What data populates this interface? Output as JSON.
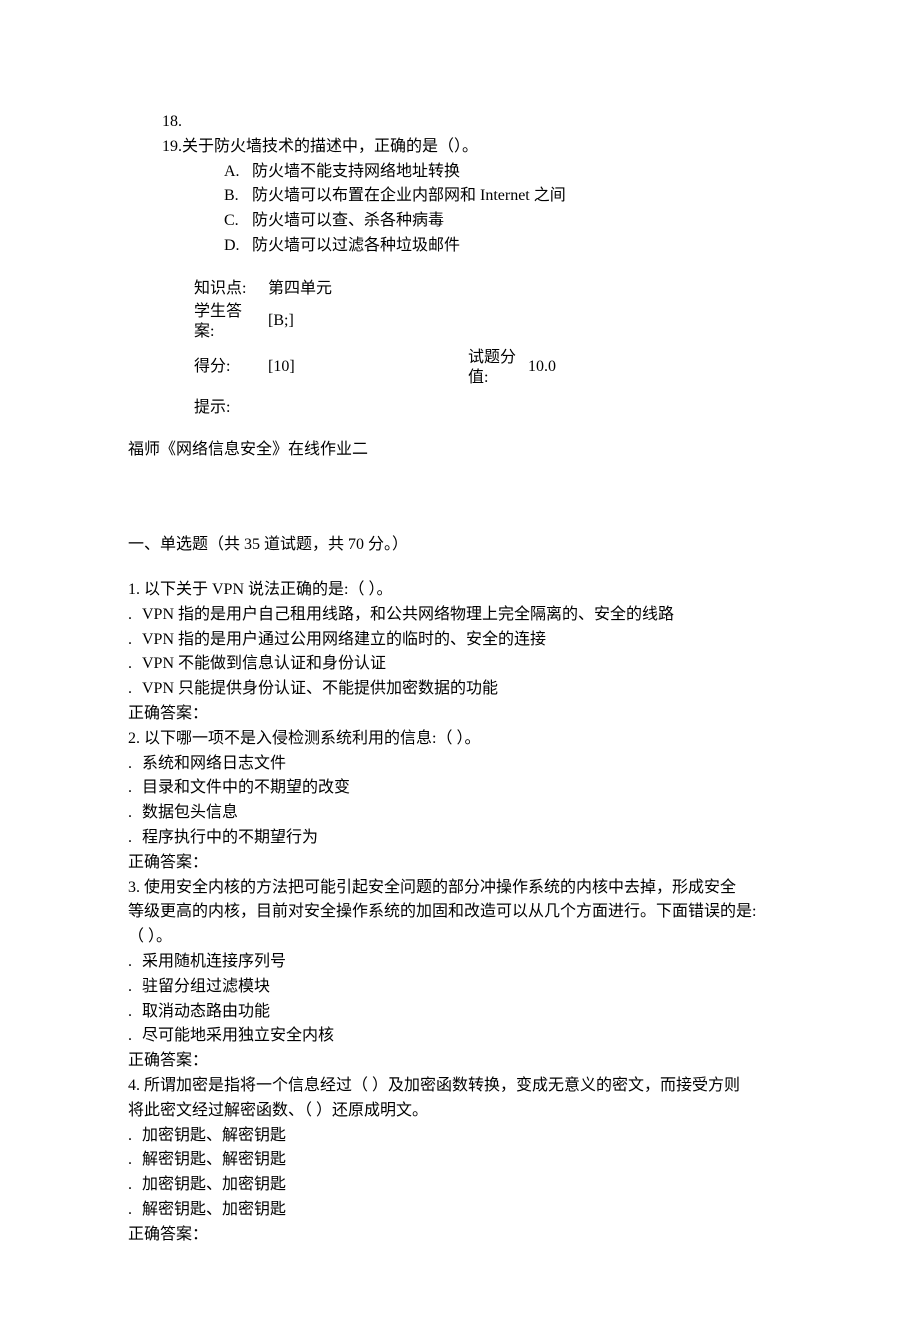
{
  "q18": {
    "num": "18."
  },
  "q19": {
    "num": "19.",
    "stem": "关于防火墙技术的描述中，正确的是（）。",
    "options": {
      "A": {
        "label": "A.",
        "text": "防火墙不能支持网络地址转换"
      },
      "B": {
        "label": "B.",
        "text": "防火墙可以布置在企业内部网和 Internet 之间"
      },
      "C": {
        "label": "C.",
        "text": "防火墙可以查、杀各种病毒"
      },
      "D": {
        "label": "D.",
        "text": "防火墙可以过滤各种垃圾邮件"
      }
    },
    "meta": {
      "knowledge_label": "知识点:",
      "knowledge_value": "第四单元",
      "student_answer_label_l1": "学生答",
      "student_answer_label_l2": "案:",
      "student_answer_value": "[B;]",
      "score_label": "得分:",
      "score_value": "[10]",
      "item_score_label_l1": "试题分",
      "item_score_label_l2": "值:",
      "item_score_value": "10.0",
      "hint_label": "提示:"
    }
  },
  "hw2": {
    "title": "福师《网络信息安全》在线作业二",
    "section_title": "一、单选题（共 35 道试题，共 70 分。）",
    "q1": {
      "stem": "1.  以下关于 VPN 说法正确的是:（ ）。",
      "opts": [
        "VPN 指的是用户自己租用线路，和公共网络物理上完全隔离的、安全的线路",
        "VPN 指的是用户通过公用网络建立的临时的、安全的连接",
        "VPN 不能做到信息认证和身份认证",
        "VPN 只能提供身份认证、不能提供加密数据的功能"
      ],
      "answer_label": "正确答案："
    },
    "q2": {
      "stem": "2.  以下哪一项不是入侵检测系统利用的信息:（ ）。",
      "opts": [
        "系统和网络日志文件",
        "目录和文件中的不期望的改变",
        "数据包头信息",
        "程序执行中的不期望行为"
      ],
      "answer_label": "正确答案："
    },
    "q3": {
      "stem_l1": "3.  使用安全内核的方法把可能引起安全问题的部分冲操作系统的内核中去掉，形成安全",
      "stem_l2": "等级更高的内核，目前对安全操作系统的加固和改造可以从几个方面进行。下面错误的是:",
      "stem_l3": "（ ）。",
      "opts": [
        "采用随机连接序列号",
        "驻留分组过滤模块",
        "取消动态路由功能",
        "尽可能地采用独立安全内核"
      ],
      "answer_label": "正确答案："
    },
    "q4": {
      "stem_l1": "4.  所谓加密是指将一个信息经过（ ）及加密函数转换，变成无意义的密文，而接受方则",
      "stem_l2": "将此密文经过解密函数、（ ）还原成明文。",
      "opts": [
        "加密钥匙、解密钥匙",
        "解密钥匙、解密钥匙",
        "加密钥匙、加密钥匙",
        "解密钥匙、加密钥匙"
      ],
      "answer_label": "正确答案："
    }
  },
  "dot": "."
}
